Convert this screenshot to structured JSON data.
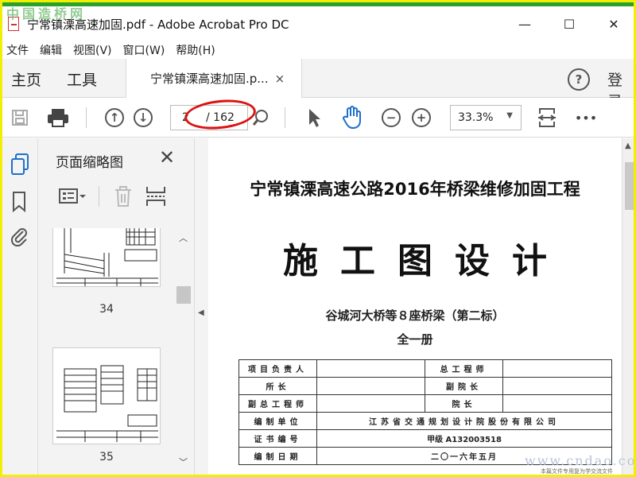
{
  "watermark_top": "中国造桥网",
  "watermark_bottom": "www.cndao.com",
  "watermark_bottom_small": "本篇文件专用复为学交流文件",
  "window": {
    "title": "宁常镇溧高速加固.pdf - Adobe Acrobat Pro DC",
    "minimize": "—",
    "maximize": "☐",
    "close": "✕"
  },
  "menu": [
    "文件",
    "编辑",
    "视图(V)",
    "窗口(W)",
    "帮助(H)"
  ],
  "tabs": {
    "home": "主页",
    "tools": "工具",
    "doc": "宁常镇溧高速加固.p...",
    "doc_close": "×",
    "help": "?",
    "signin": "登录"
  },
  "toolbar": {
    "page_current": "2",
    "page_total": "/ 162",
    "zoom": "33.3%",
    "more": "•••"
  },
  "panel": {
    "title": "页面缩略图",
    "close": "✕",
    "thumbs": [
      {
        "number": "34"
      },
      {
        "number": "35"
      }
    ]
  },
  "document": {
    "project_title": "宁常镇溧高速公路2016年桥梁维修加固工程",
    "main_title": "施工图设计",
    "subtitle": "谷城河大桥等８座桥梁（第二标）",
    "volume": "全一册",
    "table": [
      [
        "项目负责人",
        "",
        "总工程师",
        ""
      ],
      [
        "所长",
        "",
        "副院长",
        ""
      ],
      [
        "副总工程师",
        "",
        "院长",
        ""
      ]
    ],
    "table_full": [
      [
        "编制单位",
        "江苏省交通规划设计院股份有限公司"
      ],
      [
        "证书编号",
        "甲级 A132003518"
      ],
      [
        "编制日期",
        "二〇一六年五月"
      ]
    ]
  },
  "colors": {
    "frame_yellow": "#f2ee00",
    "top_green": "#2aa12a",
    "annotation_red": "#d11111",
    "acrobat_red": "#cc3333"
  }
}
